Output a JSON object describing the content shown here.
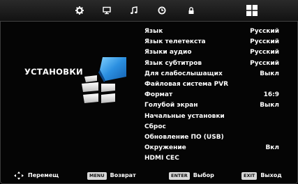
{
  "top_tabs": [
    {
      "icon": "gear-icon",
      "label": ""
    },
    {
      "icon": "monitor-icon",
      "label": ""
    },
    {
      "icon": "music-note-icon",
      "label": ""
    },
    {
      "icon": "clock-icon",
      "label": ""
    },
    {
      "icon": "lock-icon",
      "label": ""
    },
    {
      "icon": "grid-icon",
      "label": "",
      "active": true
    }
  ],
  "section": {
    "title": "УСТАНОВКИ"
  },
  "menu": {
    "items": [
      {
        "label": "Язык",
        "value": "Русский"
      },
      {
        "label": "Язык телетекста",
        "value": "Русский"
      },
      {
        "label": "Языки аудио",
        "value": "Русский"
      },
      {
        "label": "Язык субтитров",
        "value": "Русский"
      },
      {
        "label": "Для слабослышащих",
        "value": "Выкл"
      },
      {
        "label": "Файловая система PVR",
        "value": ""
      },
      {
        "label": "Формат",
        "value": "16:9"
      },
      {
        "label": "Голубой экран",
        "value": "Выкл"
      },
      {
        "label": "Начальные установки",
        "value": ""
      },
      {
        "label": "Сброс",
        "value": ""
      },
      {
        "label": "Обновление ПО (USB)",
        "value": ""
      },
      {
        "label": "Окружение",
        "value": "Вкл"
      },
      {
        "label": "HDMI CEC",
        "value": ""
      }
    ]
  },
  "hints": {
    "move": {
      "icon": "arrows-icon",
      "text": "Перемещ"
    },
    "back": {
      "key": "MENU",
      "text": "Возврат"
    },
    "select": {
      "key": "ENTER",
      "text": "Выбор"
    },
    "exit": {
      "key": "EXIT",
      "text": "Выход"
    }
  },
  "colors": {
    "background": "#000000",
    "accent_blue": "#2b8fe0",
    "text": "#ffffff"
  }
}
